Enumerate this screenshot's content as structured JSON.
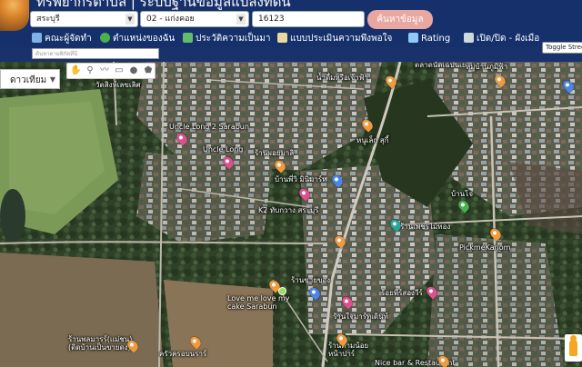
{
  "header": {
    "title": "ทรัพยากรตำบล | ระบบฐานข้อมูลแปลงที่ดิน",
    "province_select": "สระบุรี",
    "district_select": "02 - แก่งคอย",
    "code_input": "16123",
    "search_button": "ค้นหาข้อมูล"
  },
  "nav": {
    "items": [
      {
        "label": "คณะผู้จัดทำ",
        "icon": "team-icon",
        "color": "#7fb3e6"
      },
      {
        "label": "ตำแหน่งของฉัน",
        "icon": "globe-icon",
        "color": "#4caf50"
      },
      {
        "label": "ประวัติความเป็นมา",
        "icon": "sprout-icon",
        "color": "#66bb6a"
      },
      {
        "label": "แบบประเมินความพึงพอใจ",
        "icon": "form-icon",
        "color": "#e8d9a0"
      },
      {
        "label": "Rating",
        "icon": "chart-icon",
        "color": "#90caf9"
      },
      {
        "label": "เปิด/ปิด - ผังเมือง",
        "icon": "checkbox-icon",
        "color": "#cfd8dc"
      }
    ],
    "toggle_street": "Toggle Street"
  },
  "subbar": {
    "coord_placeholder": "ค้นหาตามพิกัดที่นี่"
  },
  "map": {
    "map_type": "ดาวเทียม",
    "tools": [
      "hand-icon",
      "marker-icon",
      "polyline-icon",
      "rectangle-icon",
      "circle-icon",
      "polygon-icon"
    ],
    "labels": [
      {
        "text": "วัดสิงห์เลขเลิศ"
      },
      {
        "text": "ตลาดนัดเฉปนเย"
      },
      {
        "text": "หมู่บ้านภูมิฟ้า"
      },
      {
        "text": "น้ำดื่มหรือเจ้าฟ้า"
      },
      {
        "text": "Uncle Long 2 Sarabun"
      },
      {
        "text": "หนูเล็ก สุกี้"
      },
      {
        "text": "Uncle Long"
      },
      {
        "text": "ร้านผอยมาลิ"
      },
      {
        "text": "บ้านพี่วิ มินิมาร์ท"
      },
      {
        "text": "K2 ทับกวาง สระบุรี"
      },
      {
        "text": "บ้านโจ"
      },
      {
        "text": "ร้านเพชรไม้ทอง"
      },
      {
        "text": "PickmeKanom"
      },
      {
        "text": "ร้านขายของ"
      },
      {
        "text": "Love me love my cake Sarabun"
      },
      {
        "text": "ร้อยทีร์สองวีร์"
      },
      {
        "text": "ร้านใจมาร์ทเดินท์"
      },
      {
        "text": "ร้านพลมารร์(แม่ชน) (ติดบ้านเป็นขายดง)"
      },
      {
        "text": "ครัวครอบนราร์"
      },
      {
        "text": "ร้านตามน้อย หน้าปาร์"
      },
      {
        "text": "Nice bar & Restaurant"
      }
    ]
  }
}
